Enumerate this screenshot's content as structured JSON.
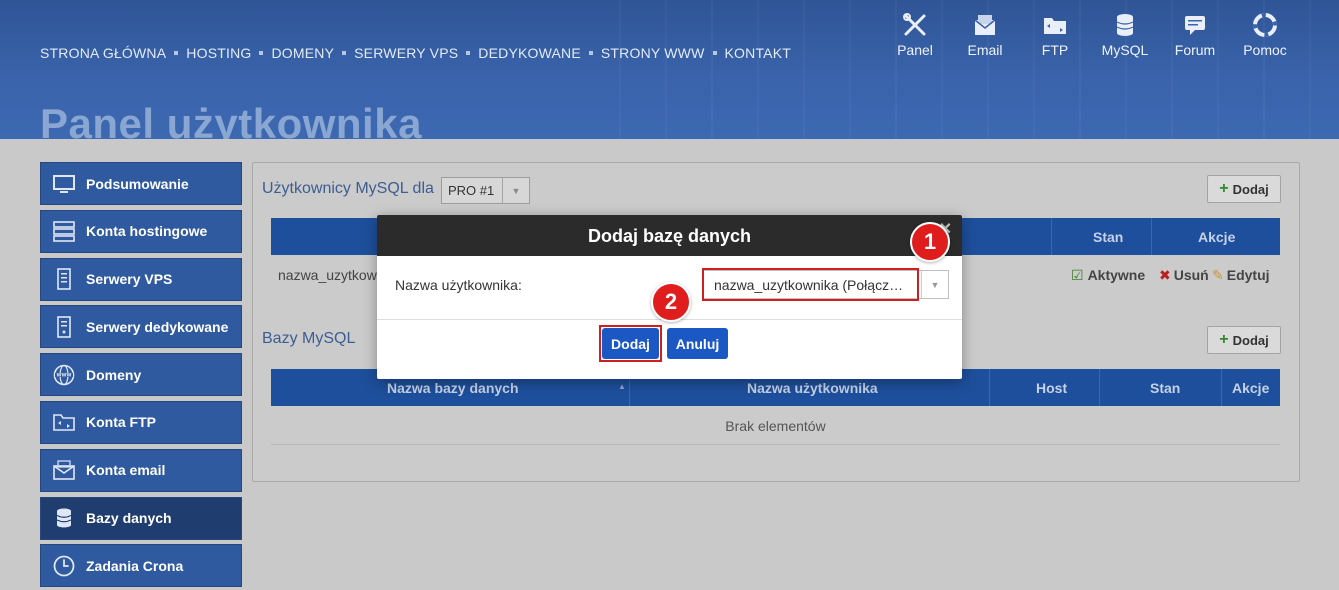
{
  "nav": {
    "items": [
      "STRONA GŁÓWNA",
      "HOSTING",
      "DOMENY",
      "SERWERY VPS",
      "DEDYKOWANE",
      "STRONY WWW",
      "KONTAKT"
    ]
  },
  "tools": [
    {
      "label": "Panel",
      "icon": "tools-icon"
    },
    {
      "label": "Email",
      "icon": "email-icon"
    },
    {
      "label": "FTP",
      "icon": "ftp-folder-icon"
    },
    {
      "label": "MySQL",
      "icon": "database-icon"
    },
    {
      "label": "Forum",
      "icon": "forum-icon"
    },
    {
      "label": "Pomoc",
      "icon": "lifebuoy-icon"
    }
  ],
  "page_title": "Panel użytkownika",
  "sidebar": {
    "items": [
      {
        "label": "Podsumowanie",
        "icon": "monitor-icon"
      },
      {
        "label": "Konta hostingowe",
        "icon": "server-icon"
      },
      {
        "label": "Serwery VPS",
        "icon": "vps-icon"
      },
      {
        "label": "Serwery dedykowane",
        "icon": "dedicated-server-icon"
      },
      {
        "label": "Domeny",
        "icon": "www-globe-icon"
      },
      {
        "label": "Konta FTP",
        "icon": "ftp-folder-icon"
      },
      {
        "label": "Konta email",
        "icon": "email-icon"
      },
      {
        "label": "Bazy danych",
        "icon": "database-icon"
      },
      {
        "label": "Zadania Crona",
        "icon": "clock-icon"
      }
    ],
    "active": "Bazy danych"
  },
  "users_section": {
    "title": "Użytkownicy MySQL dla",
    "plan_select": "PRO #1",
    "add_label": "Dodaj",
    "columns": {
      "stan": "Stan",
      "akcje": "Akcje"
    },
    "row": {
      "name": "nazwa_uzytkownika",
      "status": "Aktywne",
      "delete": "Usuń",
      "edit": "Edytuj"
    }
  },
  "db_section": {
    "title": "Bazy MySQL",
    "add_label": "Dodaj",
    "columns": {
      "db_name": "Nazwa bazy danych",
      "user_name": "Nazwa użytkownika",
      "host": "Host",
      "stan": "Stan",
      "akcje": "Akcje"
    },
    "empty": "Brak elementów"
  },
  "modal": {
    "title": "Dodaj bazę danych",
    "close": "✕",
    "label": "Nazwa użytkownika:",
    "selected_user": "nazwa_uzytkownika (Połącz…",
    "submit": "Dodaj",
    "cancel": "Anuluj"
  },
  "badges": {
    "one": "1",
    "two": "2"
  },
  "colors": {
    "header_blue": "#3a64ac",
    "sidebar_blue": "#2f5a9f",
    "table_head": "#1e4f9c",
    "primary_button": "#1b58c4",
    "highlight_red": "#d01f1f"
  }
}
